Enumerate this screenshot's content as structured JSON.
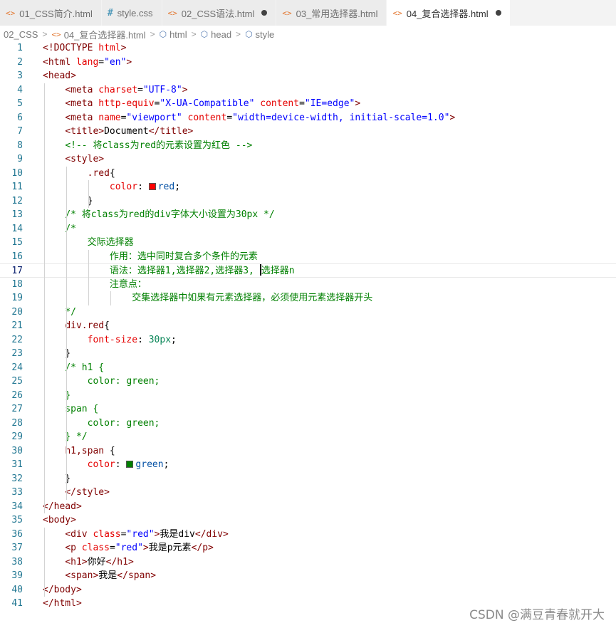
{
  "tabs": [
    {
      "icon": "<>",
      "label": "01_CSS简介.html",
      "type": "html",
      "modified": false,
      "active": false
    },
    {
      "icon": "#",
      "label": "style.css",
      "type": "css",
      "modified": false,
      "active": false
    },
    {
      "icon": "<>",
      "label": "02_CSS语法.html",
      "type": "html",
      "modified": true,
      "active": false
    },
    {
      "icon": "<>",
      "label": "03_常用选择器.html",
      "type": "html",
      "modified": false,
      "active": false
    },
    {
      "icon": "<>",
      "label": "04_复合选择器.html",
      "type": "html",
      "modified": true,
      "active": true
    }
  ],
  "breadcrumb": {
    "folder": "02_CSS",
    "file": "04_复合选择器.html",
    "node1": "html",
    "node2": "head",
    "node3": "style",
    "separator": ">"
  },
  "editor": {
    "current_line": 17,
    "lines": [
      {
        "n": "1",
        "tokens": [
          {
            "c": "tag",
            "t": "<!DOCTYPE "
          },
          {
            "c": "attr",
            "t": "html"
          },
          {
            "c": "tag",
            "t": ">"
          }
        ]
      },
      {
        "n": "2",
        "tokens": [
          {
            "c": "tag",
            "t": "<html "
          },
          {
            "c": "attr",
            "t": "lang"
          },
          {
            "c": "txt",
            "t": "="
          },
          {
            "c": "str",
            "t": "\"en\""
          },
          {
            "c": "tag",
            "t": ">"
          }
        ]
      },
      {
        "n": "3",
        "tokens": [
          {
            "c": "tag",
            "t": "<head>"
          }
        ]
      },
      {
        "n": "4",
        "tokens": [
          {
            "c": "txt",
            "t": "    "
          },
          {
            "c": "tag",
            "t": "<meta "
          },
          {
            "c": "attr",
            "t": "charset"
          },
          {
            "c": "txt",
            "t": "="
          },
          {
            "c": "str",
            "t": "\"UTF-8\""
          },
          {
            "c": "tag",
            "t": ">"
          }
        ]
      },
      {
        "n": "5",
        "tokens": [
          {
            "c": "txt",
            "t": "    "
          },
          {
            "c": "tag",
            "t": "<meta "
          },
          {
            "c": "attr",
            "t": "http-equiv"
          },
          {
            "c": "txt",
            "t": "="
          },
          {
            "c": "str",
            "t": "\"X-UA-Compatible\""
          },
          {
            "c": "txt",
            "t": " "
          },
          {
            "c": "attr",
            "t": "content"
          },
          {
            "c": "txt",
            "t": "="
          },
          {
            "c": "str",
            "t": "\"IE=edge\""
          },
          {
            "c": "tag",
            "t": ">"
          }
        ]
      },
      {
        "n": "6",
        "tokens": [
          {
            "c": "txt",
            "t": "    "
          },
          {
            "c": "tag",
            "t": "<meta "
          },
          {
            "c": "attr",
            "t": "name"
          },
          {
            "c": "txt",
            "t": "="
          },
          {
            "c": "str",
            "t": "\"viewport\""
          },
          {
            "c": "txt",
            "t": " "
          },
          {
            "c": "attr",
            "t": "content"
          },
          {
            "c": "txt",
            "t": "="
          },
          {
            "c": "str",
            "t": "\"width=device-width, initial-scale=1.0\""
          },
          {
            "c": "tag",
            "t": ">"
          }
        ]
      },
      {
        "n": "7",
        "tokens": [
          {
            "c": "txt",
            "t": "    "
          },
          {
            "c": "tag",
            "t": "<title>"
          },
          {
            "c": "txt",
            "t": "Document"
          },
          {
            "c": "tag",
            "t": "</title>"
          }
        ]
      },
      {
        "n": "8",
        "tokens": [
          {
            "c": "txt",
            "t": "    "
          },
          {
            "c": "cmt",
            "t": "<!-- 将class为red的元素设置为红色 -->"
          }
        ]
      },
      {
        "n": "9",
        "tokens": [
          {
            "c": "txt",
            "t": "    "
          },
          {
            "c": "tag",
            "t": "<style>"
          }
        ]
      },
      {
        "n": "10",
        "tokens": [
          {
            "c": "txt",
            "t": "        "
          },
          {
            "c": "sel",
            "t": ".red"
          },
          {
            "c": "txt",
            "t": "{"
          }
        ]
      },
      {
        "n": "11",
        "tokens": [
          {
            "c": "txt",
            "t": "            "
          },
          {
            "c": "prop",
            "t": "color"
          },
          {
            "c": "txt",
            "t": ": "
          },
          {
            "c": "swatch",
            "t": "#ff0000"
          },
          {
            "c": "val",
            "t": "red"
          },
          {
            "c": "txt",
            "t": ";"
          }
        ]
      },
      {
        "n": "12",
        "tokens": [
          {
            "c": "txt",
            "t": "        }"
          }
        ]
      },
      {
        "n": "13",
        "tokens": [
          {
            "c": "txt",
            "t": "    "
          },
          {
            "c": "cmt",
            "t": "/* 将class为red的div字体大小设置为30px */"
          }
        ]
      },
      {
        "n": "14",
        "tokens": [
          {
            "c": "txt",
            "t": "    "
          },
          {
            "c": "cmt",
            "t": "/*"
          }
        ]
      },
      {
        "n": "15",
        "tokens": [
          {
            "c": "txt",
            "t": "        "
          },
          {
            "c": "cmt",
            "t": "交际选择器"
          }
        ]
      },
      {
        "n": "16",
        "tokens": [
          {
            "c": "txt",
            "t": "            "
          },
          {
            "c": "cmt",
            "t": "作用：选中同时复合多个条件的元素"
          }
        ]
      },
      {
        "n": "17",
        "tokens": [
          {
            "c": "txt",
            "t": "            "
          },
          {
            "c": "cmt",
            "t": "语法：选择器1,选择器2,选择器3, "
          },
          {
            "c": "caret",
            "t": ""
          },
          {
            "c": "cmt",
            "t": "选择器n"
          }
        ]
      },
      {
        "n": "18",
        "tokens": [
          {
            "c": "txt",
            "t": "            "
          },
          {
            "c": "cmt",
            "t": "注意点："
          }
        ]
      },
      {
        "n": "19",
        "tokens": [
          {
            "c": "txt",
            "t": "                "
          },
          {
            "c": "cmt",
            "t": "交集选择器中如果有元素选择器，必须使用元素选择器开头"
          }
        ]
      },
      {
        "n": "20",
        "tokens": [
          {
            "c": "txt",
            "t": "    "
          },
          {
            "c": "cmt",
            "t": "*/"
          }
        ]
      },
      {
        "n": "21",
        "tokens": [
          {
            "c": "txt",
            "t": "    "
          },
          {
            "c": "sel",
            "t": "div.red"
          },
          {
            "c": "txt",
            "t": "{"
          }
        ]
      },
      {
        "n": "22",
        "tokens": [
          {
            "c": "txt",
            "t": "        "
          },
          {
            "c": "prop",
            "t": "font-size"
          },
          {
            "c": "txt",
            "t": ": "
          },
          {
            "c": "num",
            "t": "30px"
          },
          {
            "c": "txt",
            "t": ";"
          }
        ]
      },
      {
        "n": "23",
        "tokens": [
          {
            "c": "txt",
            "t": "    }"
          }
        ]
      },
      {
        "n": "24",
        "tokens": [
          {
            "c": "txt",
            "t": "    "
          },
          {
            "c": "cmt",
            "t": "/* h1 {"
          }
        ]
      },
      {
        "n": "25",
        "tokens": [
          {
            "c": "txt",
            "t": "        "
          },
          {
            "c": "cmt",
            "t": "color: green;"
          }
        ]
      },
      {
        "n": "26",
        "tokens": [
          {
            "c": "txt",
            "t": "    "
          },
          {
            "c": "cmt",
            "t": "}"
          }
        ]
      },
      {
        "n": "27",
        "tokens": [
          {
            "c": "txt",
            "t": "    "
          },
          {
            "c": "cmt",
            "t": "span {"
          }
        ]
      },
      {
        "n": "28",
        "tokens": [
          {
            "c": "txt",
            "t": "        "
          },
          {
            "c": "cmt",
            "t": "color: green;"
          }
        ]
      },
      {
        "n": "29",
        "tokens": [
          {
            "c": "txt",
            "t": "    "
          },
          {
            "c": "cmt",
            "t": "} */"
          }
        ]
      },
      {
        "n": "30",
        "tokens": [
          {
            "c": "txt",
            "t": "    "
          },
          {
            "c": "sel",
            "t": "h1,span"
          },
          {
            "c": "txt",
            "t": " {"
          }
        ]
      },
      {
        "n": "31",
        "tokens": [
          {
            "c": "txt",
            "t": "        "
          },
          {
            "c": "prop",
            "t": "color"
          },
          {
            "c": "txt",
            "t": ": "
          },
          {
            "c": "swatch",
            "t": "#008000"
          },
          {
            "c": "val",
            "t": "green"
          },
          {
            "c": "txt",
            "t": ";"
          }
        ]
      },
      {
        "n": "32",
        "tokens": [
          {
            "c": "txt",
            "t": "    }"
          }
        ]
      },
      {
        "n": "33",
        "tokens": [
          {
            "c": "txt",
            "t": "    "
          },
          {
            "c": "tag",
            "t": "</style>"
          }
        ]
      },
      {
        "n": "34",
        "tokens": [
          {
            "c": "tag",
            "t": "</head>"
          }
        ]
      },
      {
        "n": "35",
        "tokens": [
          {
            "c": "tag",
            "t": "<body>"
          }
        ]
      },
      {
        "n": "36",
        "tokens": [
          {
            "c": "txt",
            "t": "    "
          },
          {
            "c": "tag",
            "t": "<div "
          },
          {
            "c": "attr",
            "t": "class"
          },
          {
            "c": "txt",
            "t": "="
          },
          {
            "c": "str",
            "t": "\"red\""
          },
          {
            "c": "tag",
            "t": ">"
          },
          {
            "c": "txt",
            "t": "我是div"
          },
          {
            "c": "tag",
            "t": "</div>"
          }
        ]
      },
      {
        "n": "37",
        "tokens": [
          {
            "c": "txt",
            "t": "    "
          },
          {
            "c": "tag",
            "t": "<p "
          },
          {
            "c": "attr",
            "t": "class"
          },
          {
            "c": "txt",
            "t": "="
          },
          {
            "c": "str",
            "t": "\"red\""
          },
          {
            "c": "tag",
            "t": ">"
          },
          {
            "c": "txt",
            "t": "我是p元素"
          },
          {
            "c": "tag",
            "t": "</p>"
          }
        ]
      },
      {
        "n": "38",
        "tokens": [
          {
            "c": "txt",
            "t": "    "
          },
          {
            "c": "tag",
            "t": "<h1>"
          },
          {
            "c": "txt",
            "t": "你好"
          },
          {
            "c": "tag",
            "t": "</h1>"
          }
        ]
      },
      {
        "n": "39",
        "tokens": [
          {
            "c": "txt",
            "t": "    "
          },
          {
            "c": "tag",
            "t": "<span>"
          },
          {
            "c": "txt",
            "t": "我是"
          },
          {
            "c": "tag",
            "t": "</span>"
          }
        ]
      },
      {
        "n": "40",
        "tokens": [
          {
            "c": "tag",
            "t": "</body>"
          }
        ]
      },
      {
        "n": "41",
        "tokens": [
          {
            "c": "tag",
            "t": "</html>"
          }
        ]
      }
    ]
  },
  "watermark": "CSDN @满豆青春就开大",
  "colors": {
    "tag": "#800000",
    "attribute": "#e50000",
    "string": "#0000ff",
    "comment": "#008000",
    "number": "#098658",
    "value": "#0451a5",
    "line_number": "#237893"
  }
}
